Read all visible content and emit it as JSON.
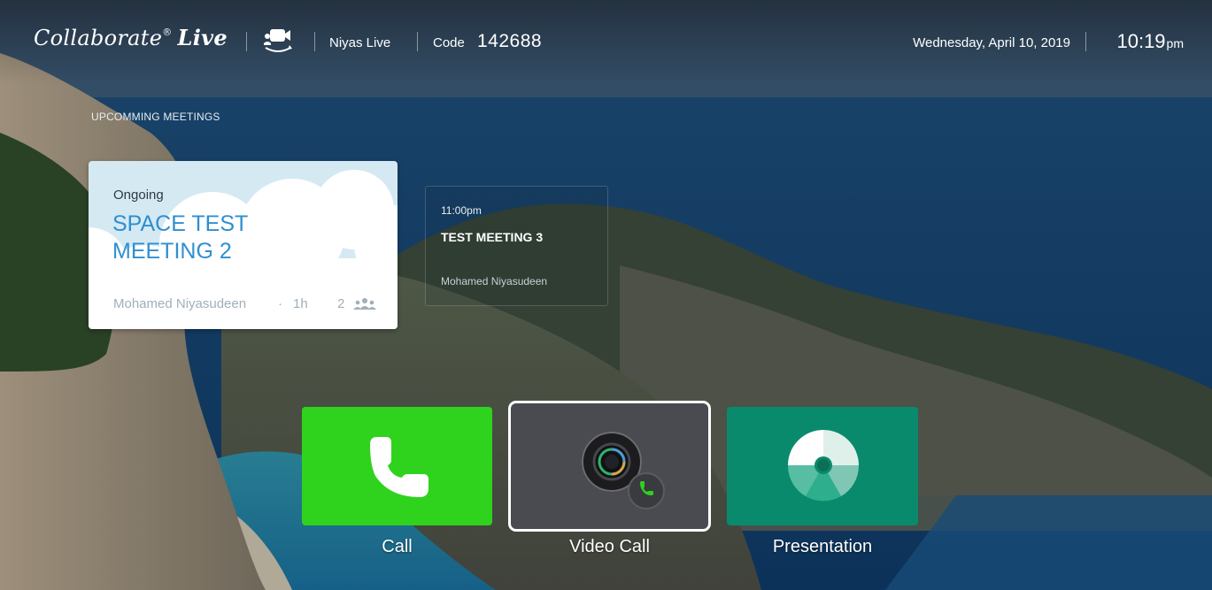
{
  "header": {
    "logo_text": "Collaborate",
    "logo_reg": "®",
    "logo_live": "Live",
    "room_name": "Niyas Live",
    "code_label": "Code",
    "code_value": "142688",
    "date": "Wednesday, April 10, 2019",
    "time": "10:19",
    "time_suffix": "pm"
  },
  "meetings": {
    "section_title": "UPCOMMING MEETINGS",
    "ongoing": {
      "status": "Ongoing",
      "title": "SPACE TEST MEETING 2",
      "host": "Mohamed Niyasudeen",
      "separator": "·",
      "duration": "1h",
      "participants": "2"
    },
    "next": {
      "time": "11:00pm",
      "title": "TEST MEETING 3",
      "host": "Mohamed Niyasudeen"
    }
  },
  "actions": [
    {
      "label": "Call",
      "icon": "phone-icon",
      "color": "#2fd21d"
    },
    {
      "label": "Video Call",
      "icon": "video-camera-icon",
      "color": "#4a4b50",
      "selected": true
    },
    {
      "label": "Presentation",
      "icon": "pie-chart-icon",
      "color": "#0a8a6c"
    }
  ],
  "colors": {
    "ongoing_title": "#2f8fd0",
    "ongoing_card_bg": "#d5e9f3"
  }
}
